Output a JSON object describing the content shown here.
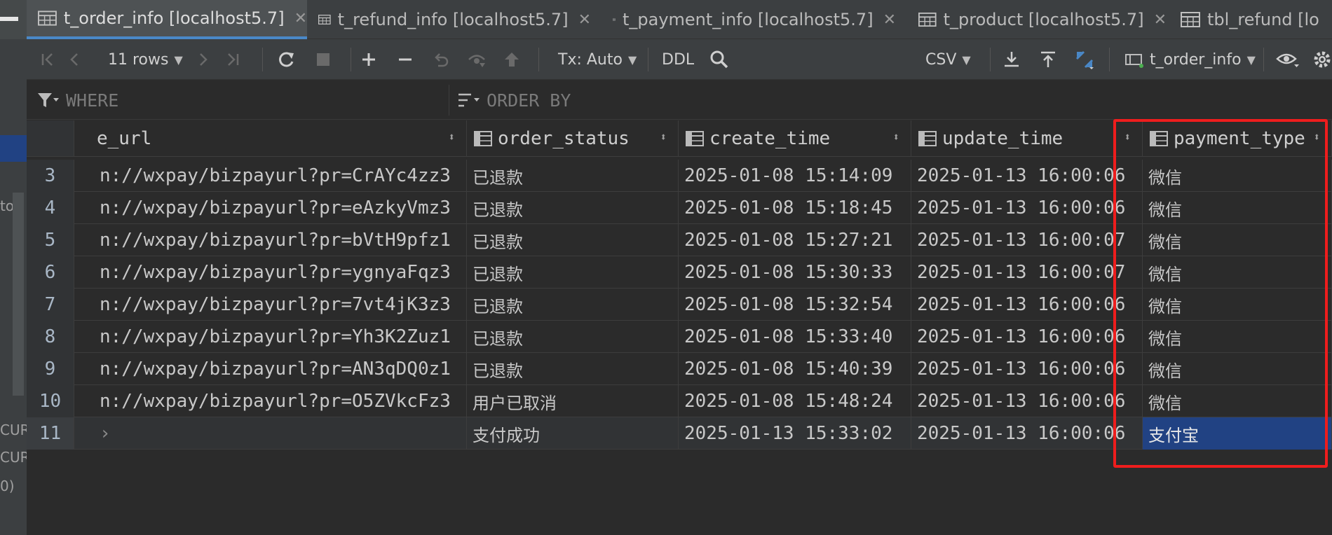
{
  "sidebar": {
    "texts": [
      "to i",
      "CUR",
      "CUR",
      "0)"
    ]
  },
  "tabs": [
    {
      "label": "t_order_info [localhost5.7]",
      "active": true
    },
    {
      "label": "t_refund_info [localhost5.7]",
      "active": false
    },
    {
      "label": "t_payment_info [localhost5.7]",
      "active": false
    },
    {
      "label": "t_product [localhost5.7]",
      "active": false
    },
    {
      "label": "tbl_refund [lo",
      "active": false
    }
  ],
  "tab_close_glyph": "✕",
  "toolbar": {
    "rows_label": "11 rows",
    "tx_label": "Tx: Auto",
    "ddl_label": "DDL",
    "csv_label": "CSV",
    "table_label": "t_order_info"
  },
  "filter": {
    "where_label": "WHERE",
    "orderby_label": "ORDER BY"
  },
  "grid": {
    "columns": [
      {
        "label": "e_url"
      },
      {
        "label": "order_status"
      },
      {
        "label": "create_time"
      },
      {
        "label": "update_time"
      },
      {
        "label": "payment_type"
      }
    ],
    "rows": [
      {
        "num": "3",
        "url": "n://wxpay/bizpayurl?pr=CrAYc4zz3",
        "status": "已退款",
        "create": "2025-01-08 15:14:09",
        "update": "2025-01-13 16:00:06",
        "payment": "微信"
      },
      {
        "num": "4",
        "url": "n://wxpay/bizpayurl?pr=eAzkyVmz3",
        "status": "已退款",
        "create": "2025-01-08 15:18:45",
        "update": "2025-01-13 16:00:06",
        "payment": "微信"
      },
      {
        "num": "5",
        "url": "n://wxpay/bizpayurl?pr=bVtH9pfz1",
        "status": "已退款",
        "create": "2025-01-08 15:27:21",
        "update": "2025-01-13 16:00:07",
        "payment": "微信"
      },
      {
        "num": "6",
        "url": "n://wxpay/bizpayurl?pr=ygnyaFqz3",
        "status": "已退款",
        "create": "2025-01-08 15:30:33",
        "update": "2025-01-13 16:00:07",
        "payment": "微信"
      },
      {
        "num": "7",
        "url": "n://wxpay/bizpayurl?pr=7vt4jK3z3",
        "status": "已退款",
        "create": "2025-01-08 15:32:54",
        "update": "2025-01-13 16:00:06",
        "payment": "微信"
      },
      {
        "num": "8",
        "url": "n://wxpay/bizpayurl?pr=Yh3K2Zuz1",
        "status": "已退款",
        "create": "2025-01-08 15:33:40",
        "update": "2025-01-13 16:00:06",
        "payment": "微信"
      },
      {
        "num": "9",
        "url": "n://wxpay/bizpayurl?pr=AN3qDQ0z1",
        "status": "已退款",
        "create": "2025-01-08 15:40:39",
        "update": "2025-01-13 16:00:06",
        "payment": "微信"
      },
      {
        "num": "10",
        "url": "n://wxpay/bizpayurl?pr=O5ZVkcFz3",
        "status": "用户已取消",
        "create": "2025-01-08 15:48:24",
        "update": "2025-01-13 16:00:06",
        "payment": "微信"
      },
      {
        "num": "11",
        "url": "›",
        "status": "支付成功",
        "create": "2025-01-13 15:33:02",
        "update": "2025-01-13 16:00:06",
        "payment": "支付宝"
      }
    ]
  },
  "colors": {
    "accent": "#4a88c7",
    "selection": "#214283",
    "highlight_box": "#ee1d1d"
  }
}
